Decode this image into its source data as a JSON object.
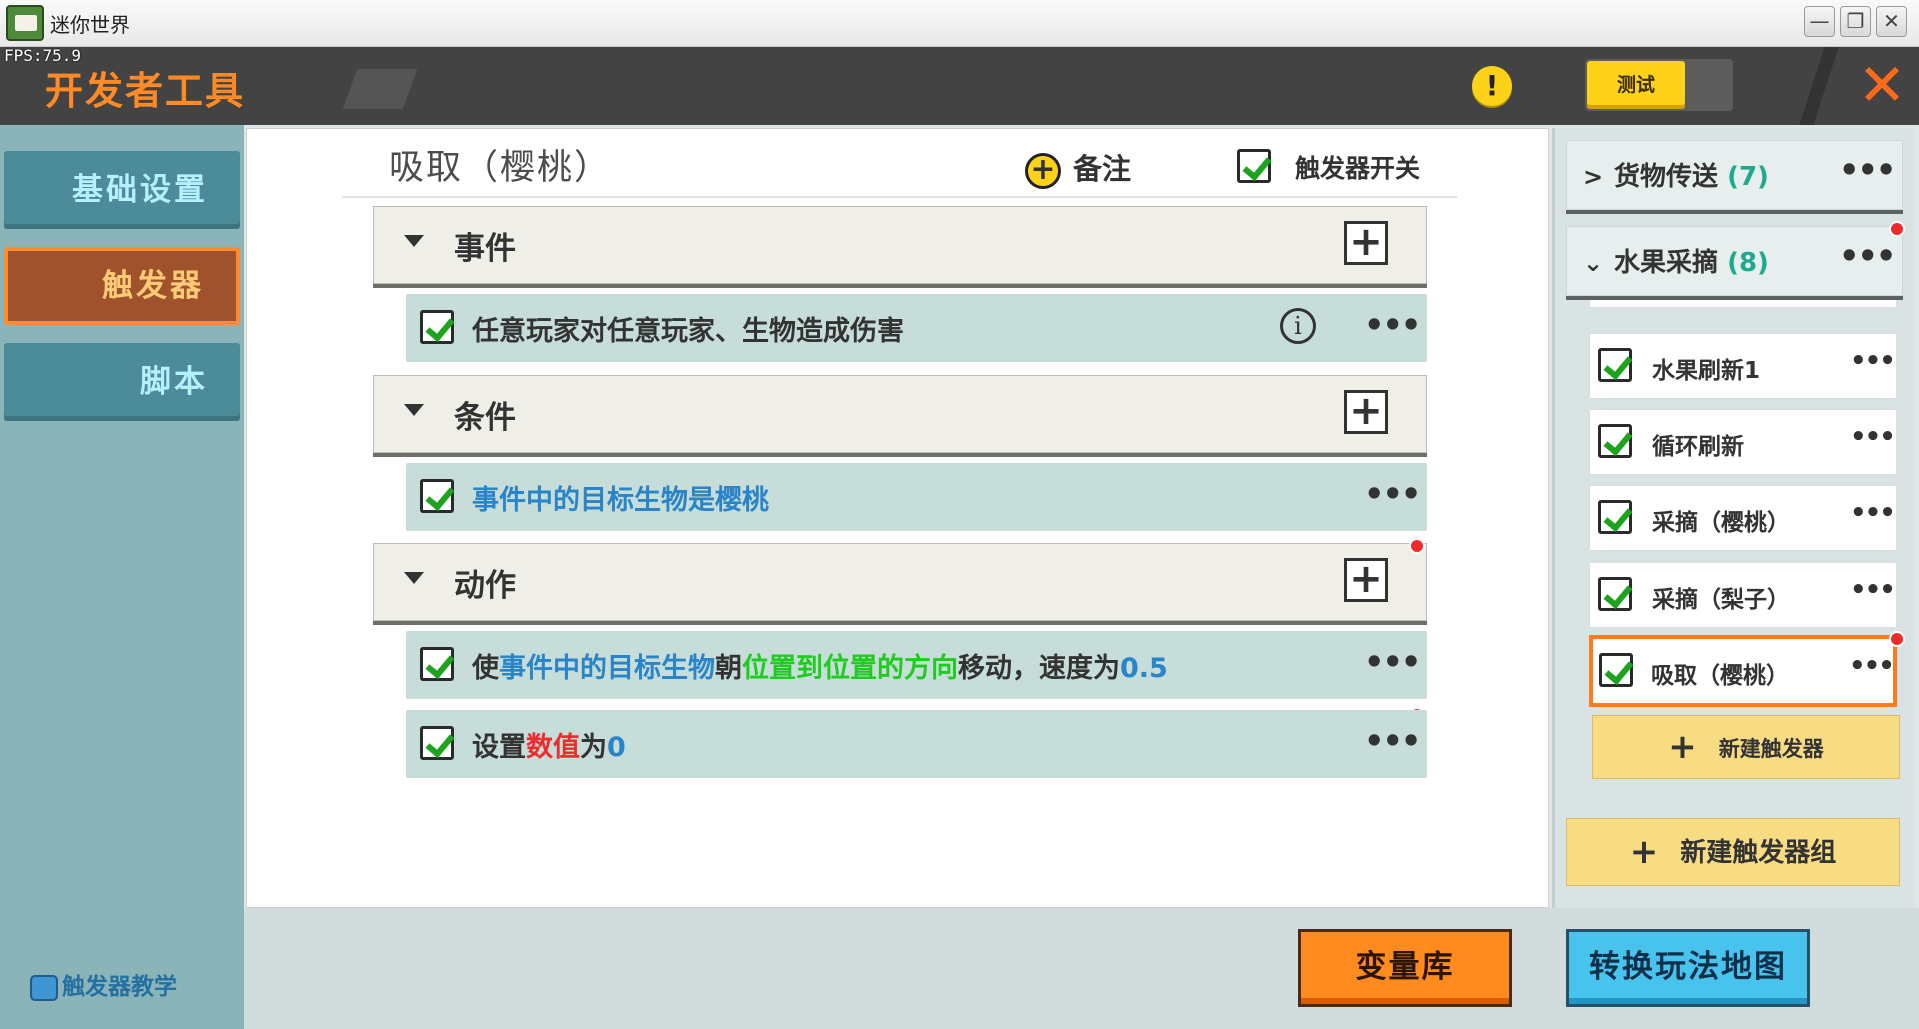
{
  "window": {
    "title": "迷你世界",
    "minimize": "—",
    "restore": "❐",
    "close": "✕"
  },
  "header": {
    "fps": "FPS:75.9",
    "title": "开发者工具",
    "warning": "!",
    "test_label": "测试",
    "close": "✕"
  },
  "sidebar": {
    "tabs": [
      {
        "label": "基础设置"
      },
      {
        "label": "触发器"
      },
      {
        "label": "脚本"
      }
    ],
    "tutorial": "触发器教学"
  },
  "editor": {
    "trigger_title": "吸取（樱桃）",
    "note_label": "备注",
    "trigger_switch_label": "触发器开关",
    "sections": {
      "event": {
        "label": "事件"
      },
      "condition": {
        "label": "条件"
      },
      "action": {
        "label": "动作"
      }
    },
    "event_row": {
      "text": "任意玩家对任意玩家、生物造成伤害"
    },
    "condition_row": {
      "text": "事件中的目标生物是樱桃"
    },
    "action_row1": {
      "p1": "使",
      "p2": "事件中的目标生物",
      "p3": "朝",
      "p4": "位置到位置的方向",
      "p5": "移动，速度为",
      "p6": "0.5"
    },
    "action_row2": {
      "p1": "设置",
      "p2": "数值",
      "p3": "为",
      "p4": "0"
    },
    "dots": "•••",
    "info": "i"
  },
  "right_panel": {
    "group1": {
      "label": "货物传送",
      "count": "(7)"
    },
    "group2": {
      "label": "水果采摘",
      "count": "(8)"
    },
    "items": [
      {
        "label": "水果刷新1"
      },
      {
        "label": "循环刷新"
      },
      {
        "label": "采摘（樱桃）"
      },
      {
        "label": "采摘（梨子）"
      },
      {
        "label": "吸取（樱桃）"
      }
    ],
    "new_trigger": "新建触发器",
    "new_group": "新建触发器组"
  },
  "bottom": {
    "variable_library": "变量库",
    "convert_map": "转换玩法地图"
  },
  "colors": {
    "accent_orange": "#ff8a26",
    "highlight_blue": "#2a84c8",
    "highlight_green": "#1ecc1e",
    "highlight_red": "#ef2b2b",
    "count_teal": "#1fa98e"
  }
}
